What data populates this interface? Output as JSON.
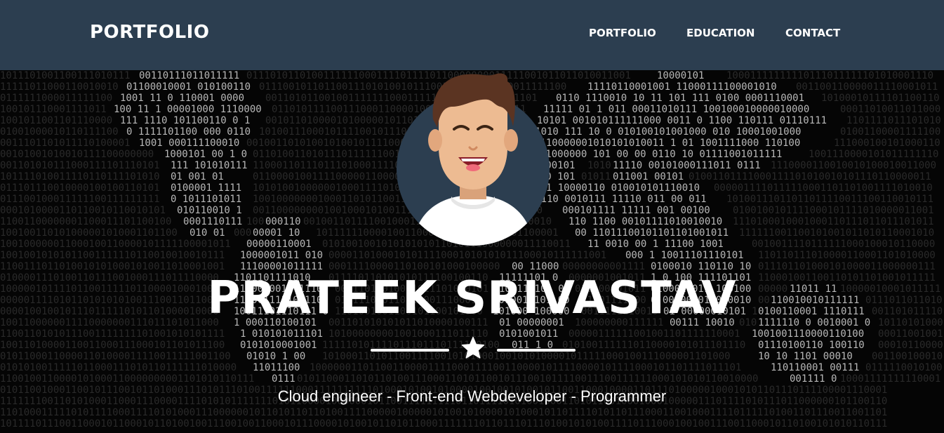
{
  "navbar": {
    "brand": "PORTFOLIO",
    "links": [
      {
        "label": "PORTFOLIO"
      },
      {
        "label": "EDUCATION"
      },
      {
        "label": "CONTACT"
      }
    ]
  },
  "hero": {
    "name": "PRATEEK SRIVASTAV",
    "subtitle": "Cloud engineer - Front-end Webdeveloper - Programmer",
    "divider_icon": "star-icon",
    "avatar_icon": "avatar-illustration"
  },
  "colors": {
    "navbar_bg": "#2c3e50",
    "hero_bg": "#050505",
    "text": "#ffffff",
    "avatar_bg": "#2c3e50"
  }
}
